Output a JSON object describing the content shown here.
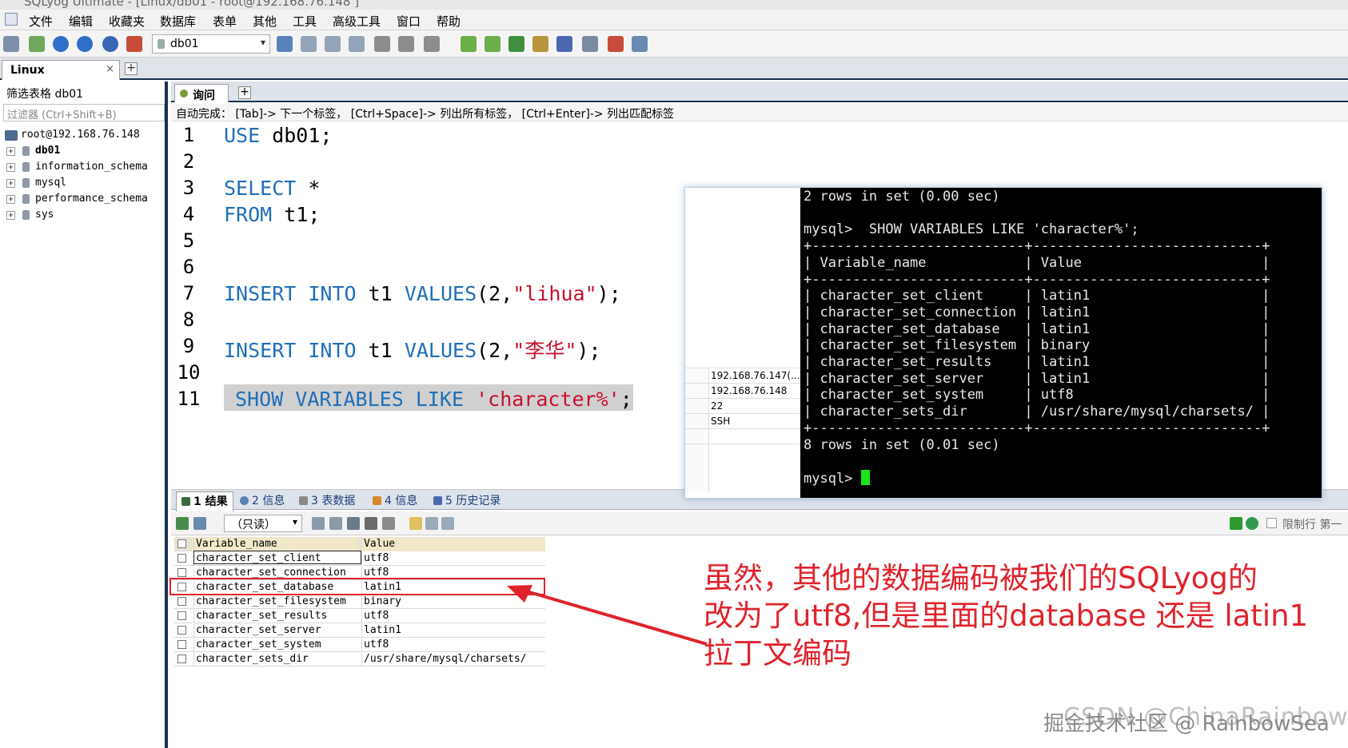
{
  "window": {
    "title": "SQLyog Ultimate - [Linux/db01 - root@192.168.76.148 ]"
  },
  "menu": [
    "文件",
    "编辑",
    "收藏夹",
    "数据库",
    "表单",
    "其他",
    "工具",
    "高级工具",
    "窗口",
    "帮助"
  ],
  "toolbar": {
    "database_selected": "db01"
  },
  "connection_tab": {
    "label": "Linux",
    "close": "×",
    "add": "+"
  },
  "left_panel": {
    "filter_label": "筛选表格  db01",
    "filter_placeholder": "过滤器 (Ctrl+Shift+B)",
    "server": "root@192.168.76.148",
    "databases": [
      "db01",
      "information_schema",
      "mysql",
      "performance_schema",
      "sys"
    ]
  },
  "query_tab": {
    "label": "询问",
    "add": "+"
  },
  "autocomplete_hint": "自动完成：  [Tab]-> 下一个标签，  [Ctrl+Space]-> 列出所有标签，  [Ctrl+Enter]-> 列出匹配标签",
  "editor": {
    "line_numbers": [
      "1",
      "2",
      "3",
      "4",
      "5",
      "6",
      "7",
      "8",
      "9",
      "10",
      "11"
    ],
    "line1": {
      "kw": "USE",
      "rest": " db01;"
    },
    "line3": {
      "kw": "SELECT",
      "rest": " *"
    },
    "line4": {
      "kw": "FROM",
      "rest": " t1;"
    },
    "line7": {
      "kw1": "INSERT",
      "kw2": "INTO",
      "t": " t1 ",
      "kw3": "VALUES",
      "p1": "(2,",
      "str": "\"lihua\"",
      "p2": ");"
    },
    "line9": {
      "kw1": "INSERT",
      "kw2": "INTO",
      "t": " t1 ",
      "kw3": "VALUES",
      "p1": "(2,",
      "str": "\"李华\"",
      "p2": ");"
    },
    "line11": {
      "kw1": "SHOW",
      "kw2": "VARIABLES",
      "kw3": "LIKE",
      "str": "'character%'",
      "end": ";"
    }
  },
  "overlay": {
    "side_rows": [
      "192.168.76.147(...",
      "192.168.76.148",
      "22",
      "SSH",
      ""
    ],
    "terminal_lines": [
      "2 rows in set (0.00 sec)",
      "",
      "mysql>  SHOW VARIABLES LIKE 'character%';",
      "+--------------------------+----------------------------+",
      "| Variable_name            | Value                      |",
      "+--------------------------+----------------------------+",
      "| character_set_client     | latin1                     |",
      "| character_set_connection | latin1                     |",
      "| character_set_database   | latin1                     |",
      "| character_set_filesystem | binary                     |",
      "| character_set_results    | latin1                     |",
      "| character_set_server     | latin1                     |",
      "| character_set_system     | utf8                       |",
      "| character_sets_dir       | /usr/share/mysql/charsets/ |",
      "+--------------------------+----------------------------+",
      "8 rows in set (0.01 sec)",
      ""
    ],
    "prompt": "mysql> "
  },
  "result_tabs": [
    "1 结果",
    "2 信息",
    "3 表数据",
    "4 信息",
    "5 历史记录"
  ],
  "result_toolbar": {
    "mode": "（只读）",
    "limit_label": "限制行  第一"
  },
  "grid": {
    "headers": [
      "Variable_name",
      "Value"
    ],
    "rows": [
      [
        "character_set_client",
        "utf8"
      ],
      [
        "character_set_connection",
        "utf8"
      ],
      [
        "character_set_database",
        "latin1"
      ],
      [
        "character_set_filesystem",
        "binary"
      ],
      [
        "character_set_results",
        "utf8"
      ],
      [
        "character_set_server",
        "latin1"
      ],
      [
        "character_set_system",
        "utf8"
      ],
      [
        "character_sets_dir",
        "/usr/share/mysql/charsets/"
      ]
    ]
  },
  "annotation": {
    "line1": "虽然，其他的数据编码被我们的SQLyog的",
    "line2": "改为了utf8,但是里面的database 还是 latin1",
    "line3": "拉丁文编码"
  },
  "watermark": {
    "csdn": "CSDN @ChinaRainbowSea",
    "juejin": "掘金技术社区 @ RainbowSea"
  },
  "colors": {
    "keyword": "#1f6fb8",
    "string": "#c8102e",
    "annotation": "#e0232b",
    "cursor": "#19e619",
    "divider": "#16314f"
  }
}
